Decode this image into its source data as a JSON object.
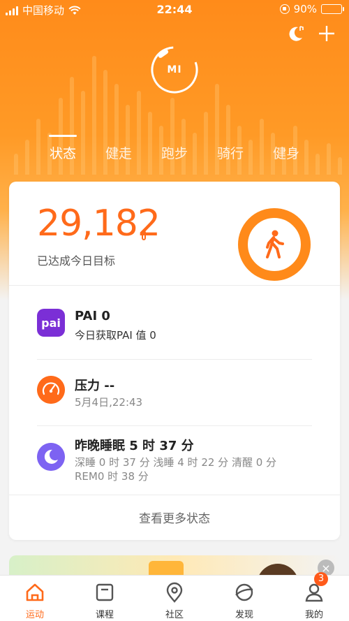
{
  "status_bar": {
    "carrier": "中国移动",
    "time": "22:44",
    "battery": "90%"
  },
  "tabs": [
    {
      "label": "状态",
      "active": true
    },
    {
      "label": "健走",
      "active": false
    },
    {
      "label": "跑步",
      "active": false
    },
    {
      "label": "骑行",
      "active": false
    },
    {
      "label": "健身",
      "active": false
    }
  ],
  "device_logo": "MI",
  "steps": {
    "value": "29,182",
    "caption": "已达成今日目标",
    "goal_progress": 1.0
  },
  "rows": {
    "pai": {
      "icon_text": "pai",
      "title": "PAI 0",
      "subtitle": "今日获取PAI 值 0"
    },
    "stress": {
      "title": "压力 --",
      "subtitle": "5月4日,22:43"
    },
    "sleep": {
      "title": "昨晚睡眠 5 时 37 分",
      "detail_line1": "深睡 0 时 37 分 浅睡 4 时 22 分 清醒 0 分",
      "detail_line2": "REM0 时 38 分"
    }
  },
  "more_label": "查看更多状态",
  "banner": {
    "close_label": "×"
  },
  "nav": [
    {
      "label": "运动",
      "icon": "home-icon",
      "active": true
    },
    {
      "label": "课程",
      "icon": "course-icon",
      "active": false
    },
    {
      "label": "社区",
      "icon": "community-icon",
      "active": false
    },
    {
      "label": "发现",
      "icon": "discover-icon",
      "active": false
    },
    {
      "label": "我的",
      "icon": "profile-icon",
      "active": false,
      "badge": "3"
    }
  ],
  "colors": {
    "accent": "#ff6a1a",
    "hero": "#ff8b1a",
    "pai": "#7b2fd6",
    "sleep": "#7d63f2"
  }
}
